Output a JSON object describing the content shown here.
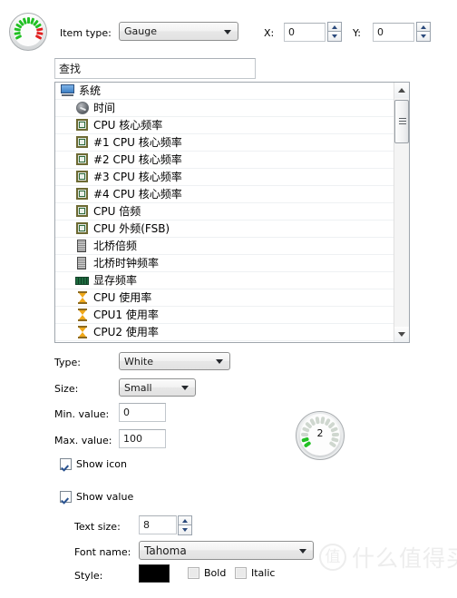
{
  "header": {
    "app_icon": "gauge-icon",
    "item_type_label": "Item type:",
    "item_type_value": "Gauge",
    "x_label": "X:",
    "x_value": "0",
    "y_label": "Y:",
    "y_value": "0"
  },
  "search": {
    "value": "查找",
    "placeholder": "查找"
  },
  "tree": {
    "root": {
      "label": "系统",
      "icon": "monitor-icon"
    },
    "items": [
      {
        "label": "时间",
        "icon": "clock-icon"
      },
      {
        "label": "CPU 核心频率",
        "icon": "cpu-icon"
      },
      {
        "label": "#1 CPU 核心频率",
        "icon": "cpu-icon"
      },
      {
        "label": "#2 CPU 核心频率",
        "icon": "cpu-icon"
      },
      {
        "label": "#3 CPU 核心频率",
        "icon": "cpu-icon"
      },
      {
        "label": "#4 CPU 核心频率",
        "icon": "cpu-icon"
      },
      {
        "label": "CPU 倍频",
        "icon": "cpu-icon"
      },
      {
        "label": "CPU 外频(FSB)",
        "icon": "cpu-icon"
      },
      {
        "label": "北桥倍频",
        "icon": "chip-icon"
      },
      {
        "label": "北桥时钟频率",
        "icon": "chip-icon"
      },
      {
        "label": "显存频率",
        "icon": "ram-icon"
      },
      {
        "label": "CPU 使用率",
        "icon": "hourglass-icon"
      },
      {
        "label": "CPU1 使用率",
        "icon": "hourglass-icon"
      },
      {
        "label": "CPU2 使用率",
        "icon": "hourglass-icon"
      }
    ]
  },
  "properties": {
    "type_label": "Type:",
    "type_value": "White",
    "size_label": "Size:",
    "size_value": "Small",
    "min_label": "Min. value:",
    "min_value": "0",
    "max_label": "Max. value:",
    "max_value": "100",
    "show_icon_label": "Show icon",
    "show_icon_checked": true,
    "show_value_label": "Show value",
    "show_value_checked": true,
    "text_size_label": "Text size:",
    "text_size_value": "8",
    "font_name_label": "Font name:",
    "font_name_value": "Tahoma",
    "style_label": "Style:",
    "style_color": "#000000",
    "bold_label": "Bold",
    "bold_checked": false,
    "italic_label": "Italic",
    "italic_checked": false
  },
  "preview": {
    "gauge_value": "2",
    "filled_segments": 2,
    "total_segments": 14,
    "fill_color": "#22c024",
    "empty_color": "#cfd7cf"
  },
  "watermark": {
    "logo_char": "值",
    "text": "什么值得买"
  }
}
